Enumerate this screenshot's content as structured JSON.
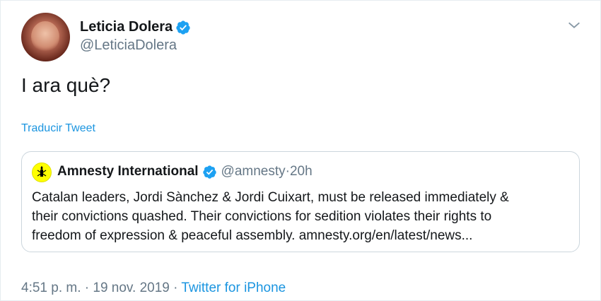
{
  "tweet": {
    "author_name": "Leticia Dolera",
    "author_handle": "@LeticiaDolera",
    "text": "I ara què?",
    "translate_label": "Traducir Tweet",
    "footer": {
      "time": "4:51 p. m.",
      "sep1": " · ",
      "date": "19 nov. 2019",
      "sep2": " · ",
      "source": "Twitter for iPhone"
    }
  },
  "quoted": {
    "author_name": "Amnesty International",
    "author_handle": "@amnesty",
    "sep": " · ",
    "age": "20h",
    "lines": [
      "Catalan leaders, Jordi Sànchez & Jordi Cuixart, must be released immediately &",
      "their convictions quashed. Their convictions for sedition violates their rights to",
      "freedom of expression & peaceful assembly. amnesty.org/en/latest/news..."
    ]
  },
  "colors": {
    "accent": "#1b95e0",
    "verified": "#1da1f2",
    "muted": "#657786",
    "amnesty_yellow": "#ffff00"
  },
  "icons": [
    "avatar",
    "verified-badge-icon",
    "chevron-down-icon",
    "amnesty-candle-icon"
  ]
}
